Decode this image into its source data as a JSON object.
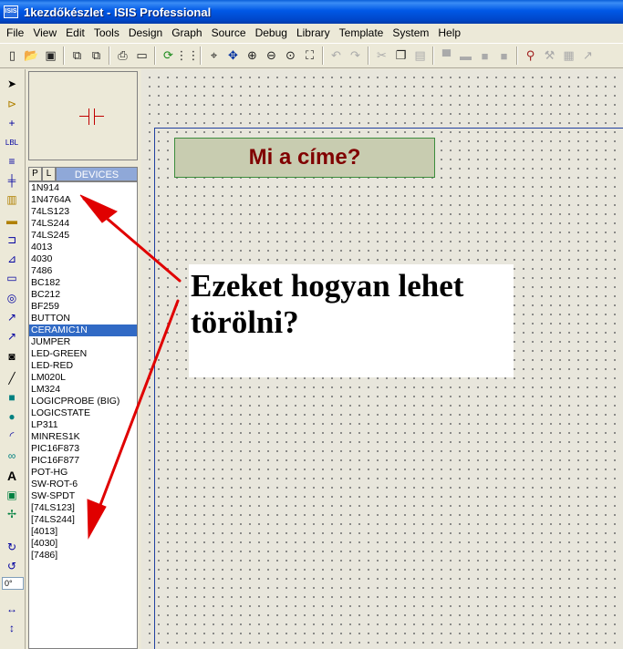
{
  "window": {
    "app_icon_text": "ISIS",
    "title": "1kezdőkészlet - ISIS Professional"
  },
  "menu": [
    "File",
    "View",
    "Edit",
    "Tools",
    "Design",
    "Graph",
    "Source",
    "Debug",
    "Library",
    "Template",
    "System",
    "Help"
  ],
  "device_selector": {
    "p_label": "P",
    "l_label": "L",
    "title": "DEVICES",
    "selected_index": 12,
    "items": [
      "1N914",
      "1N4764A",
      "74LS123",
      "74LS244",
      "74LS245",
      "4013",
      "4030",
      "7486",
      "BC182",
      "BC212",
      "BF259",
      "BUTTON",
      "CERAMIC1N",
      "JUMPER",
      "LED-GREEN",
      "LED-RED",
      "LM020L",
      "LM324",
      "LOGICPROBE (BIG)",
      "LOGICSTATE",
      "LP311",
      "MINRES1K",
      "PIC16F873",
      "PIC16F877",
      "POT-HG",
      "SW-ROT-6",
      "SW-SPDT",
      "[74LS123]",
      "[74LS244]",
      "[4013]",
      "[4030]",
      "[7486]"
    ]
  },
  "rotation": {
    "angle": "0°"
  },
  "canvas": {
    "title_box": "Mi a címe?",
    "callout_line1": "Ezeket hogyan lehet",
    "callout_line2": "törölni?"
  },
  "colors": {
    "titlebar": "#0058e6",
    "selection": "#316ac5",
    "title_text": "#800000",
    "arrow": "#e00000",
    "sheet_border": "#2040a0"
  },
  "icons": {
    "toolbar": [
      "new-file-icon",
      "open-folder-icon",
      "save-icon",
      "import-icon",
      "export-icon",
      "print-icon",
      "print-area-icon",
      "refresh-icon",
      "grid-icon",
      "origin-icon",
      "pan-icon",
      "zoom-in-icon",
      "zoom-out-icon",
      "zoom-all-icon",
      "zoom-area-icon",
      "undo-icon",
      "redo-icon",
      "cut-icon",
      "copy-icon",
      "paste-icon",
      "block-copy-icon",
      "block-move-icon",
      "block-rotate-icon",
      "block-delete-icon",
      "pick-device-icon",
      "make-device-icon",
      "package-icon",
      "decompose-icon"
    ],
    "left_tools": [
      "select-icon",
      "component-icon",
      "junction-icon",
      "wire-label-icon",
      "script-icon",
      "bus-icon",
      "subcircuit-icon",
      "terminal-icon",
      "pin-icon",
      "graph-icon",
      "tape-icon",
      "generator-icon",
      "voltage-probe-icon",
      "current-probe-icon",
      "virtual-instrument-icon",
      "line-icon",
      "box-icon",
      "circle-icon",
      "arc-icon",
      "path-icon",
      "text-icon",
      "symbol-icon",
      "marker-icon",
      "rotate-cw-icon",
      "rotate-ccw-icon",
      "mirror-h-icon",
      "mirror-v-icon"
    ]
  }
}
